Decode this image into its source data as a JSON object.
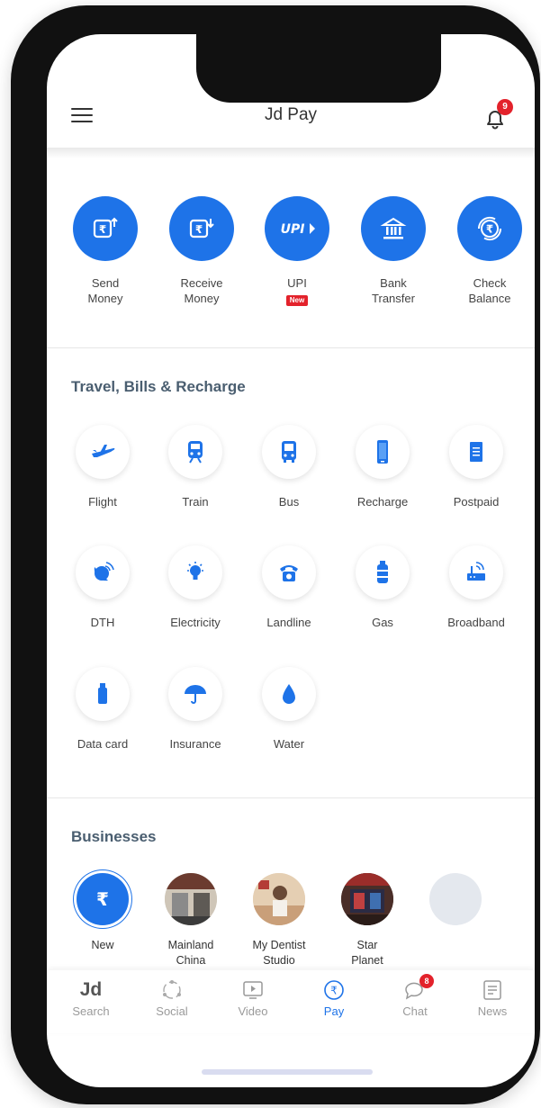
{
  "header": {
    "title": "Jd Pay",
    "notification_count": "9"
  },
  "quick_actions": [
    {
      "line1": "Send",
      "line2": "Money",
      "icon": "send-money-icon"
    },
    {
      "line1": "Receive",
      "line2": "Money",
      "icon": "receive-money-icon"
    },
    {
      "line1": "UPI",
      "badge": "New",
      "icon": "upi-logo-icon",
      "logo_text": "UPI"
    },
    {
      "line1": "Bank",
      "line2": "Transfer",
      "icon": "bank-icon"
    },
    {
      "line1": "Check",
      "line2": "Balance",
      "icon": "check-balance-icon"
    }
  ],
  "travel_section": {
    "title": "Travel, Bills & Recharge",
    "items": [
      {
        "label": "Flight",
        "icon": "flight-icon"
      },
      {
        "label": "Train",
        "icon": "train-icon"
      },
      {
        "label": "Bus",
        "icon": "bus-icon"
      },
      {
        "label": "Recharge",
        "icon": "mobile-recharge-icon"
      },
      {
        "label": "Postpaid",
        "icon": "postpaid-bill-icon"
      },
      {
        "label": "DTH",
        "icon": "dth-dish-icon"
      },
      {
        "label": "Electricity",
        "icon": "bulb-icon"
      },
      {
        "label": "Landline",
        "icon": "telephone-icon"
      },
      {
        "label": "Gas",
        "icon": "gas-cylinder-icon"
      },
      {
        "label": "Broadband",
        "icon": "router-icon"
      },
      {
        "label": "Data card",
        "icon": "data-card-icon"
      },
      {
        "label": "Insurance",
        "icon": "umbrella-icon"
      },
      {
        "label": "Water",
        "icon": "water-drop-icon"
      }
    ]
  },
  "businesses": {
    "title": "Businesses",
    "items": [
      {
        "line1": "New",
        "icon": "rupee-icon"
      },
      {
        "line1": "Mainland",
        "line2": "China"
      },
      {
        "line1": "My Dentist",
        "line2": "Studio"
      },
      {
        "line1": "Star",
        "line2": "Planet"
      }
    ]
  },
  "tabbar": [
    {
      "label": "Search",
      "logo": "Jd"
    },
    {
      "label": "Social",
      "icon": "social-icon"
    },
    {
      "label": "Video",
      "icon": "video-icon"
    },
    {
      "label": "Pay",
      "icon": "pay-icon",
      "active": true
    },
    {
      "label": "Chat",
      "icon": "chat-icon",
      "badge": "8"
    },
    {
      "label": "News",
      "icon": "news-icon"
    }
  ],
  "colors": {
    "accent": "#1e73e8",
    "badge": "#e3222b",
    "section_title": "#4a5e70"
  }
}
